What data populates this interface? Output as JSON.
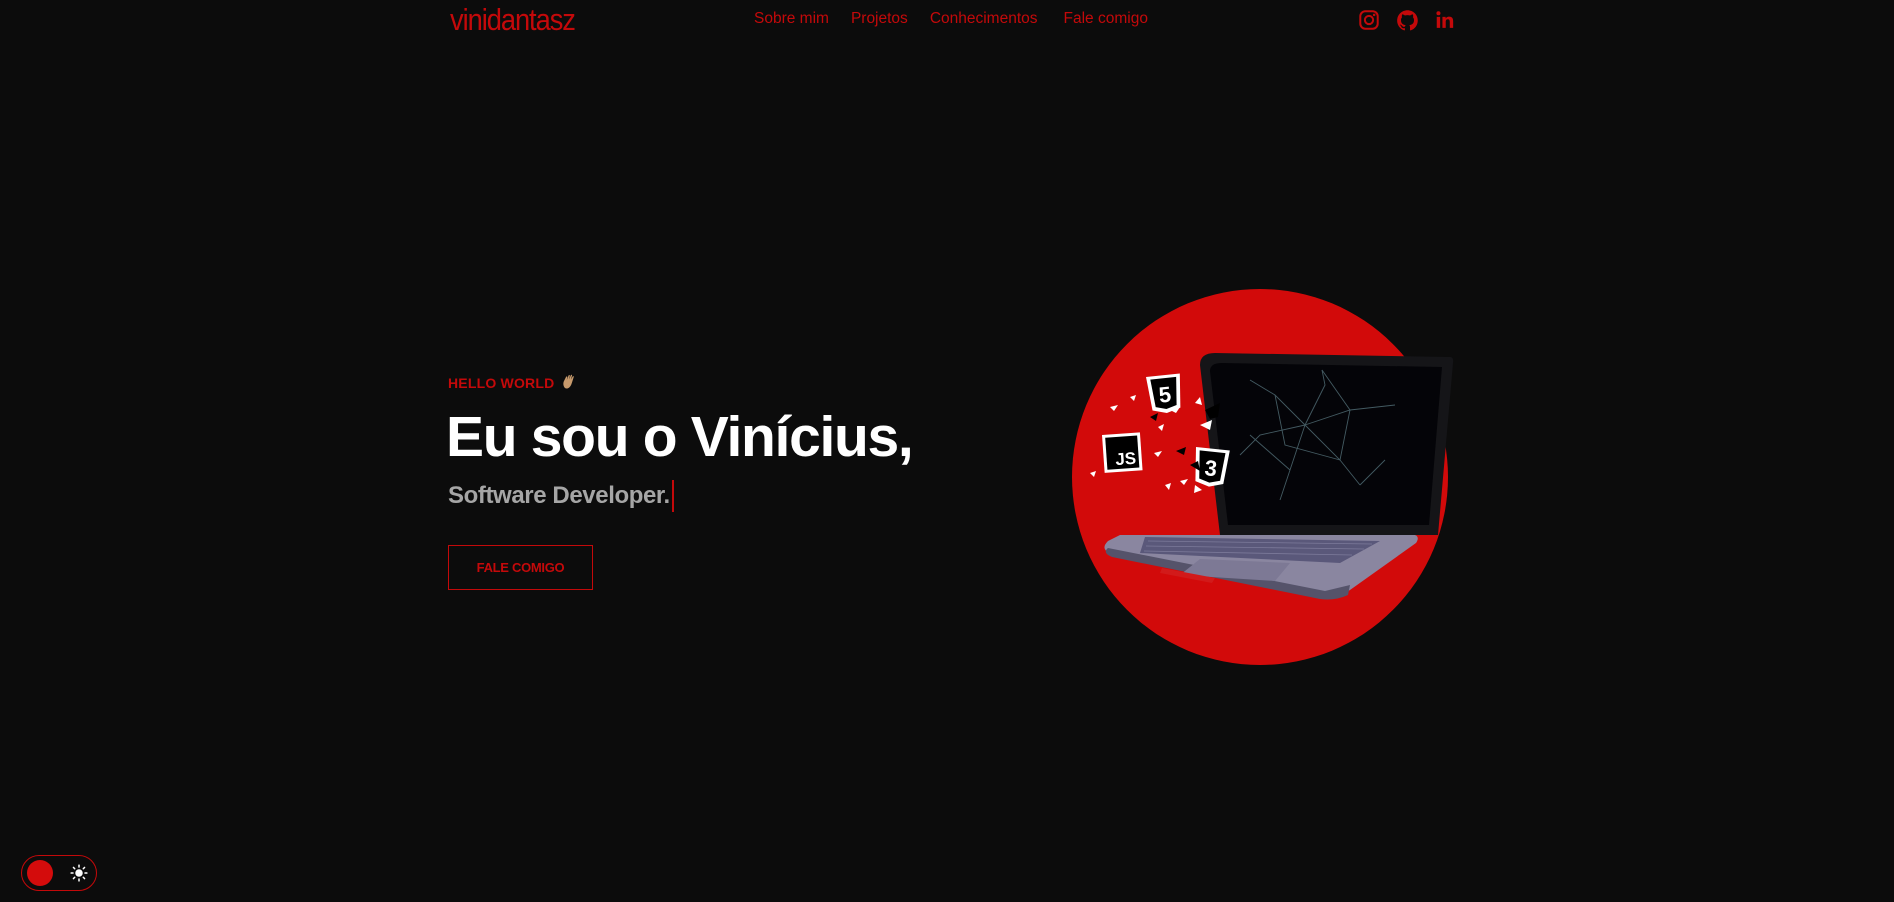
{
  "brand": {
    "logo_text": "vinidantasz",
    "accent_color": "#c4090a",
    "background_color": "#0c0c0c"
  },
  "nav": {
    "links": [
      {
        "label": "Sobre mim"
      },
      {
        "label": "Projetos"
      },
      {
        "label": "Conhecimentos"
      },
      {
        "label": "Fale comigo"
      }
    ]
  },
  "social": [
    {
      "icon": "instagram-icon"
    },
    {
      "icon": "github-icon"
    },
    {
      "icon": "linkedin-icon"
    }
  ],
  "hero": {
    "tag": "HELLO WORLD",
    "tag_icon": "waving-hand-icon",
    "title": "Eu sou o Vinícius,",
    "subtitle": "Software Developer.",
    "cta_label": "FALE COMIGO",
    "illustration": {
      "description_icons": [
        "html5-icon",
        "javascript-icon",
        "css3-icon",
        "laptop-icon"
      ],
      "circle_color": "#d40b0b"
    }
  },
  "theme_toggle": {
    "icon": "sun-icon",
    "state": "dark"
  }
}
